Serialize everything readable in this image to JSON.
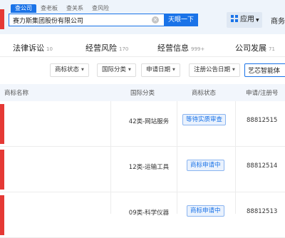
{
  "header": {
    "search_tabs": [
      "查公司",
      "查老板",
      "查关系",
      "查风险"
    ],
    "search_value": "赛力斯集团股份有限公司",
    "search_button": "天眼一下",
    "apps_label": "应用",
    "business_link": "商务"
  },
  "category_tabs": [
    {
      "label": "法律诉讼",
      "count": "10"
    },
    {
      "label": "经营风险",
      "count": "170"
    },
    {
      "label": "经营信息",
      "count": "999+"
    },
    {
      "label": "公司发展",
      "count": "71"
    }
  ],
  "filters": [
    "商标状态",
    "国际分类",
    "申请日期",
    "注册公告日期"
  ],
  "filter_search_value": "艺芯智能体",
  "table": {
    "columns": [
      "商标名称",
      "国际分类",
      "商标状态",
      "申请/注册号"
    ],
    "rows": [
      {
        "class": "42类-网站服务",
        "status": "等待实质审查",
        "reg_no": "88812515"
      },
      {
        "class": "12类-运输工具",
        "status": "商标申请中",
        "reg_no": "88812514"
      },
      {
        "class": "09类-科学仪器",
        "status": "商标申请中",
        "reg_no": "88812513"
      }
    ]
  },
  "colors": {
    "accent": "#1a73e8",
    "brand_red": "#e53935",
    "header_bg": "#eef4fb"
  }
}
